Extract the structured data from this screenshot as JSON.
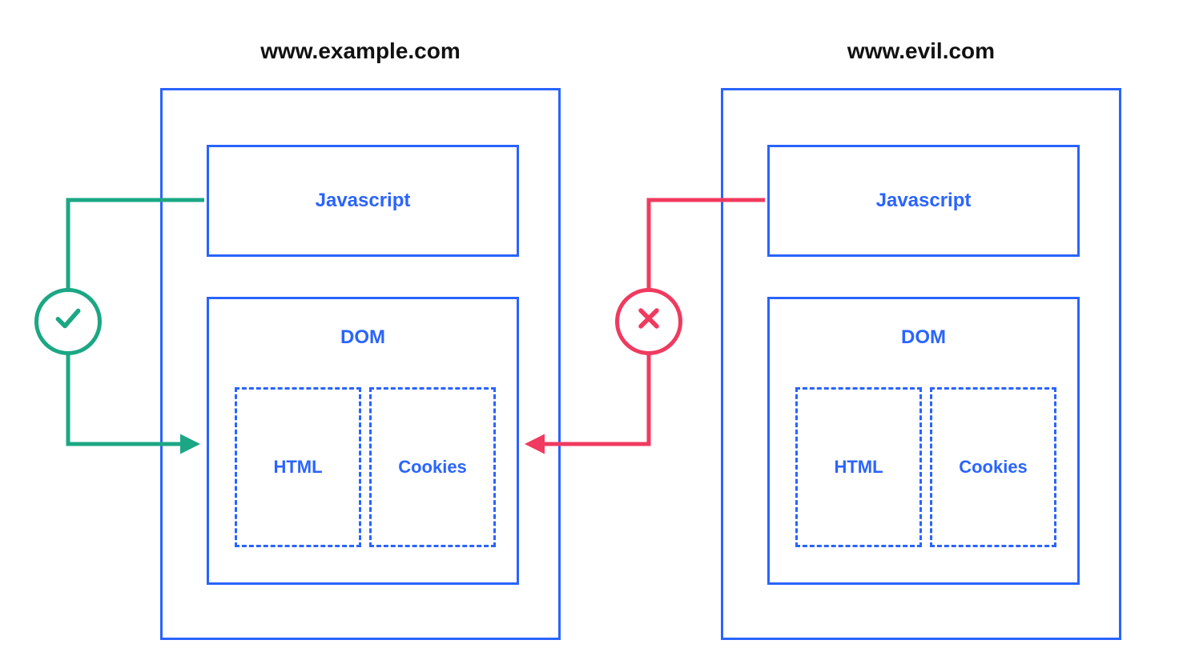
{
  "colors": {
    "blue": "#2a64ff",
    "green": "#1ba784",
    "red": "#f03a5f",
    "black": "#111111"
  },
  "left": {
    "title": "www.example.com",
    "javascript": "Javascript",
    "dom": "DOM",
    "html": "HTML",
    "cookies": "Cookies"
  },
  "right": {
    "title": "www.evil.com",
    "javascript": "Javascript",
    "dom": "DOM",
    "html": "HTML",
    "cookies": "Cookies"
  },
  "badges": {
    "allow_icon": "check-icon",
    "deny_icon": "cross-icon"
  }
}
